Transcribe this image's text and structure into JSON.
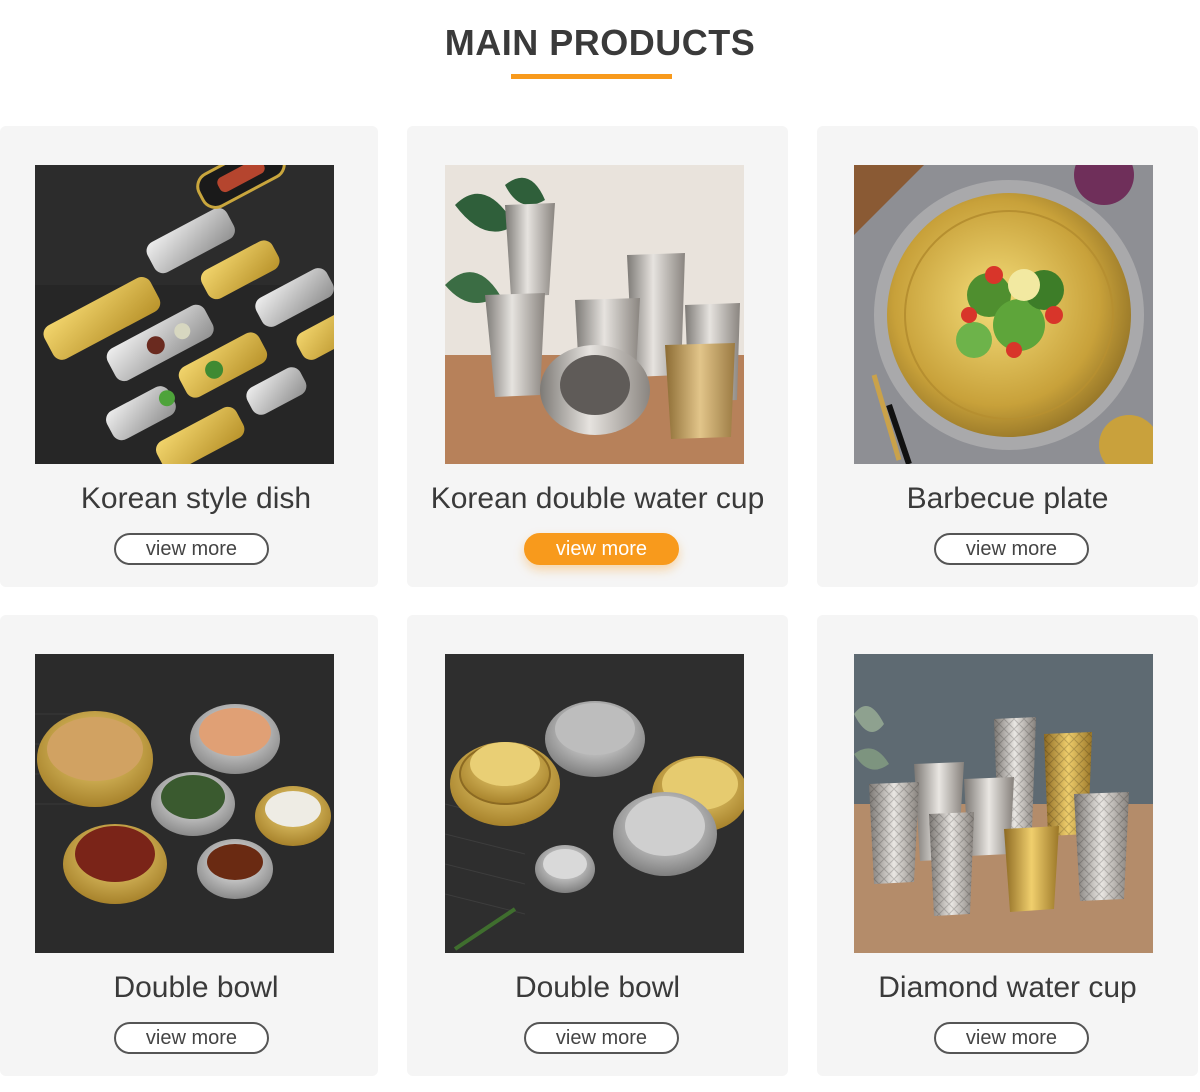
{
  "section": {
    "title": "MAIN PRODUCTS",
    "accent_color": "#f89a1c"
  },
  "products": [
    {
      "name": "Korean style dish",
      "button": "view more",
      "image": "korean-style-dish-photo",
      "active": false
    },
    {
      "name": "Korean double water cup",
      "button": "view more",
      "image": "double-water-cup-photo",
      "active": true
    },
    {
      "name": "Barbecue plate",
      "button": "view more",
      "image": "barbecue-plate-photo",
      "active": false
    },
    {
      "name": "Double bowl",
      "button": "view more",
      "image": "double-bowl-photo",
      "active": false
    },
    {
      "name": "Double bowl",
      "button": "view more",
      "image": "double-bowl-stack-photo",
      "active": false
    },
    {
      "name": "Diamond water cup",
      "button": "view more",
      "image": "diamond-water-cup-photo",
      "active": false
    }
  ]
}
